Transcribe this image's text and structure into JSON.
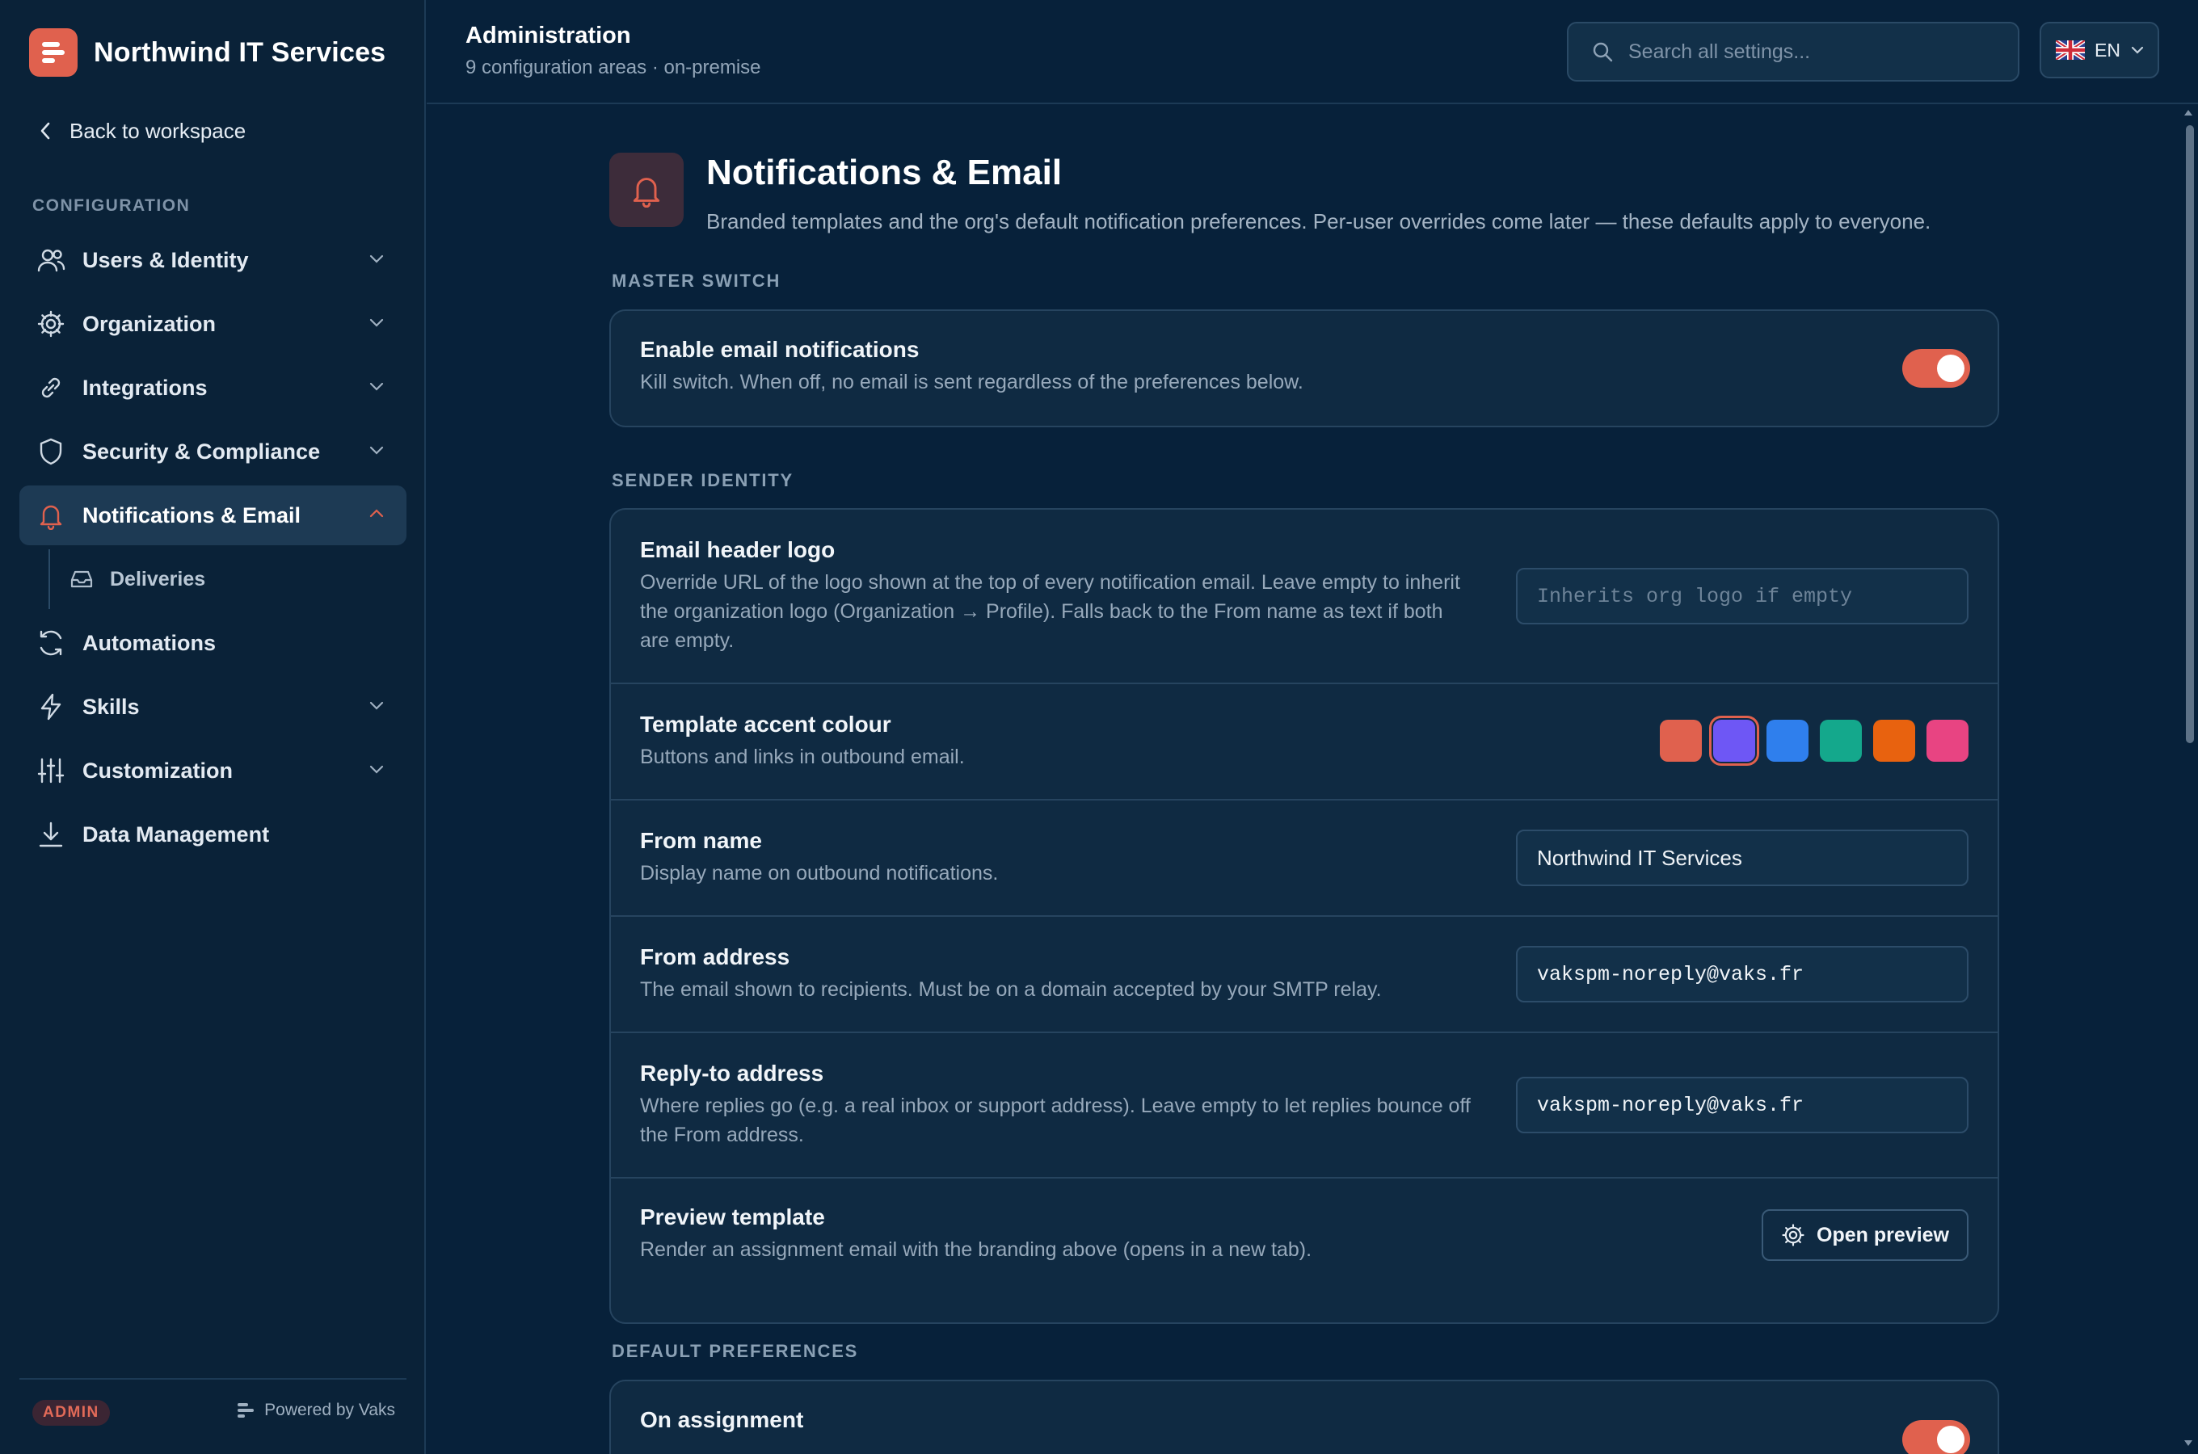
{
  "brand": {
    "name": "Northwind IT Services",
    "accent": "#e0614e"
  },
  "sidebar": {
    "back_label": "Back to workspace",
    "section_label": "CONFIGURATION",
    "items": [
      {
        "label": "Users & Identity",
        "icon": "users-icon",
        "expandable": true
      },
      {
        "label": "Organization",
        "icon": "gear-icon",
        "expandable": true
      },
      {
        "label": "Integrations",
        "icon": "link-icon",
        "expandable": true
      },
      {
        "label": "Security & Compliance",
        "icon": "shield-icon",
        "expandable": true
      },
      {
        "label": "Notifications & Email",
        "icon": "bell-icon",
        "expandable": true,
        "active": true,
        "children": [
          {
            "label": "Deliveries",
            "icon": "inbox-icon"
          }
        ]
      },
      {
        "label": "Automations",
        "icon": "refresh-icon",
        "expandable": false
      },
      {
        "label": "Skills",
        "icon": "lightning-icon",
        "expandable": true
      },
      {
        "label": "Customization",
        "icon": "sliders-icon",
        "expandable": true
      },
      {
        "label": "Data Management",
        "icon": "download-icon",
        "expandable": false
      }
    ],
    "footer": {
      "badge": "ADMIN",
      "powered_by": "Powered by Vaks"
    }
  },
  "topbar": {
    "title": "Administration",
    "subtitle": "9 configuration areas · on-premise",
    "search_placeholder": "Search all settings...",
    "language": "EN"
  },
  "page": {
    "title": "Notifications & Email",
    "description": "Branded templates and the org's default notification preferences. Per-user overrides come later — these defaults apply to everyone."
  },
  "master_switch": {
    "label": "MASTER SWITCH",
    "title": "Enable email notifications",
    "description": "Kill switch. When off, no email is sent regardless of the preferences below.",
    "enabled": true
  },
  "sender_identity": {
    "label": "SENDER IDENTITY",
    "logo": {
      "title": "Email header logo",
      "description": "Override URL of the logo shown at the top of every notification email. Leave empty to inherit the organization logo (Organization → Profile). Falls back to the From name as text if both are empty.",
      "placeholder": "Inherits org logo if empty",
      "value": ""
    },
    "accent": {
      "title": "Template accent colour",
      "description": "Buttons and links in outbound email.",
      "colors": [
        "#e0614e",
        "#6e57f5",
        "#2f7fed",
        "#14a88c",
        "#e8620f",
        "#e84482"
      ],
      "selected_index": 1
    },
    "from_name": {
      "title": "From name",
      "description": "Display name on outbound notifications.",
      "value": "Northwind IT Services"
    },
    "from_address": {
      "title": "From address",
      "description": "The email shown to recipients. Must be on a domain accepted by your SMTP relay.",
      "value": "vakspm-noreply@vaks.fr"
    },
    "reply_to": {
      "title": "Reply-to address",
      "description": "Where replies go (e.g. a real inbox or support address). Leave empty to let replies bounce off the From address.",
      "value": "vakspm-noreply@vaks.fr"
    },
    "preview": {
      "title": "Preview template",
      "description": "Render an assignment email with the branding above (opens in a new tab).",
      "button": "Open preview"
    }
  },
  "default_preferences": {
    "label": "DEFAULT PREFERENCES",
    "items": [
      {
        "title": "On assignment",
        "enabled": true
      }
    ]
  }
}
